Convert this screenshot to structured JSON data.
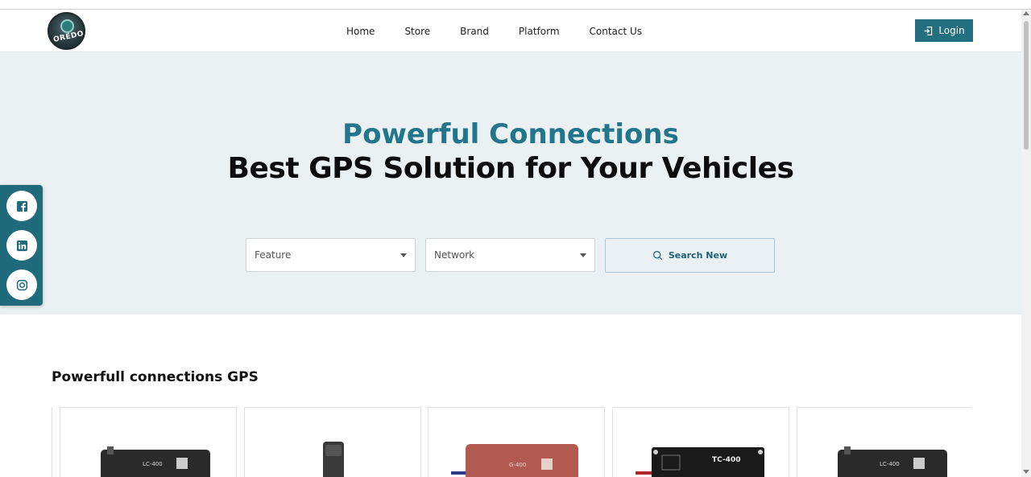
{
  "header": {
    "logo_text": "OREDO",
    "nav": [
      "Home",
      "Store",
      "Brand",
      "Platform",
      "Contact Us"
    ],
    "login_label": "Login"
  },
  "hero": {
    "title_line1": "Powerful Connections",
    "title_line2": "Best GPS Solution for Your Vehicles",
    "feature_placeholder": "Feature",
    "network_placeholder": "Network",
    "search_label": "Search New"
  },
  "social": [
    "facebook-icon",
    "linkedin-icon",
    "instagram-icon"
  ],
  "section": {
    "title": "Powerfull connections GPS",
    "products": [
      {
        "label": "LC-400",
        "color": "#2a2a2a"
      },
      {
        "label": "",
        "color": "#3a3a3a"
      },
      {
        "label": "G-400",
        "color": "#b25a4f"
      },
      {
        "label": "TC-400",
        "color": "#1a1a1a"
      },
      {
        "label": "LC-400",
        "color": "#2a2a2a"
      }
    ]
  },
  "colors": {
    "accent": "#236f80",
    "title_accent": "#22758a",
    "hero_bg": "#ebf1f3"
  }
}
